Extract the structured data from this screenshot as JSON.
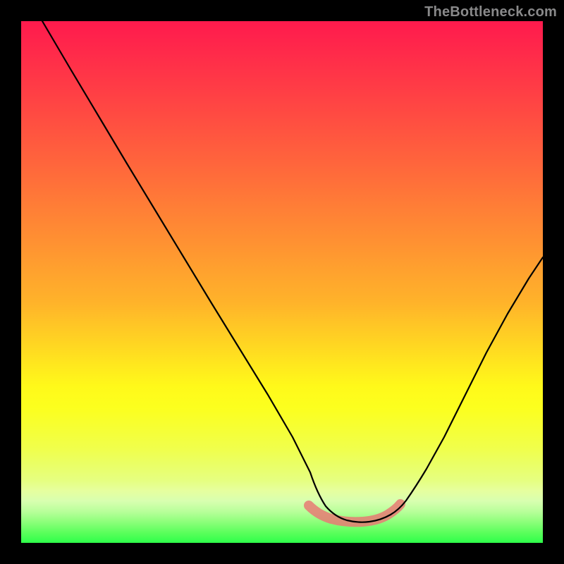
{
  "watermark": "TheBottleneck.com",
  "chart_data": {
    "type": "line",
    "title": "",
    "xlabel": "",
    "ylabel": "",
    "xlim": [
      0,
      100
    ],
    "ylim": [
      0,
      100
    ],
    "background_gradient_colors_top_to_bottom": [
      "#ff1a4d",
      "#ff4b42",
      "#ff7f36",
      "#ffb32a",
      "#ffe81e",
      "#fcff1e",
      "#eaff66",
      "#e6ff9e",
      "#8cff7a",
      "#2eff4a"
    ],
    "series": [
      {
        "name": "curve",
        "x": [
          5,
          10,
          15,
          20,
          25,
          30,
          35,
          40,
          45,
          50,
          55,
          58,
          60,
          62,
          66,
          70,
          74,
          78,
          82,
          86,
          90,
          94,
          98,
          100
        ],
        "y": [
          100,
          91,
          82,
          73,
          64,
          55,
          46,
          37,
          28,
          19,
          11,
          7,
          5,
          4,
          4,
          4,
          5,
          8,
          13,
          20,
          28,
          37,
          47,
          52
        ]
      }
    ],
    "highlight_segment": {
      "name": "optimal-zone",
      "color": "#e87a74",
      "x": [
        56,
        58,
        60,
        62,
        64,
        66,
        68,
        70,
        72
      ],
      "y": [
        7,
        5.5,
        4.6,
        4.2,
        4.1,
        4.2,
        4.5,
        5.2,
        6.5
      ]
    }
  }
}
